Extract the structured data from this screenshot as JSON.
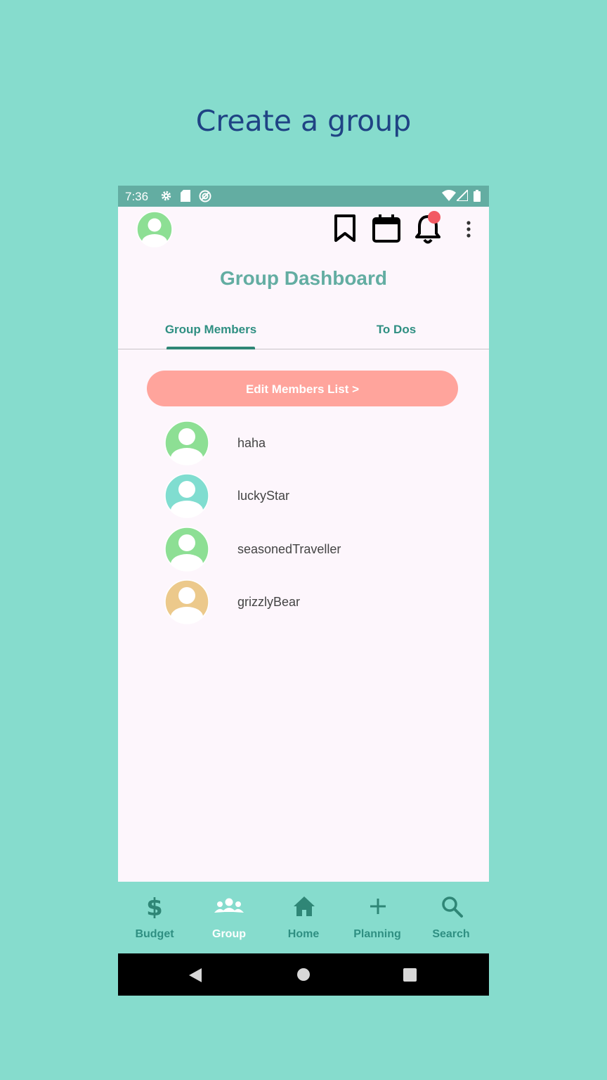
{
  "caption": "Create a group",
  "status_bar": {
    "time": "7:36"
  },
  "app": {
    "title": "Group Dashboard",
    "tabs": [
      {
        "label": "Group Members",
        "active": true
      },
      {
        "label": "To Dos",
        "active": false
      }
    ],
    "edit_button": "Edit Members List >",
    "members": [
      {
        "name": "haha",
        "avatar_color": "#8ddf94"
      },
      {
        "name": "luckyStar",
        "avatar_color": "#80ddd0"
      },
      {
        "name": "seasonedTraveller",
        "avatar_color": "#8ddf94"
      },
      {
        "name": "grizzlyBear",
        "avatar_color": "#ecc98b"
      }
    ]
  },
  "bottom_nav": [
    {
      "label": "Budget",
      "icon": "dollar-icon",
      "active": false
    },
    {
      "label": "Group",
      "icon": "group-icon",
      "active": true
    },
    {
      "label": "Home",
      "icon": "home-icon",
      "active": false
    },
    {
      "label": "Planning",
      "icon": "plus-icon",
      "active": false
    },
    {
      "label": "Search",
      "icon": "search-icon",
      "active": false
    }
  ],
  "colors": {
    "accent": "#63ada2",
    "button": "#ffa49c",
    "notification": "#f25a63",
    "background": "#86dccd"
  }
}
